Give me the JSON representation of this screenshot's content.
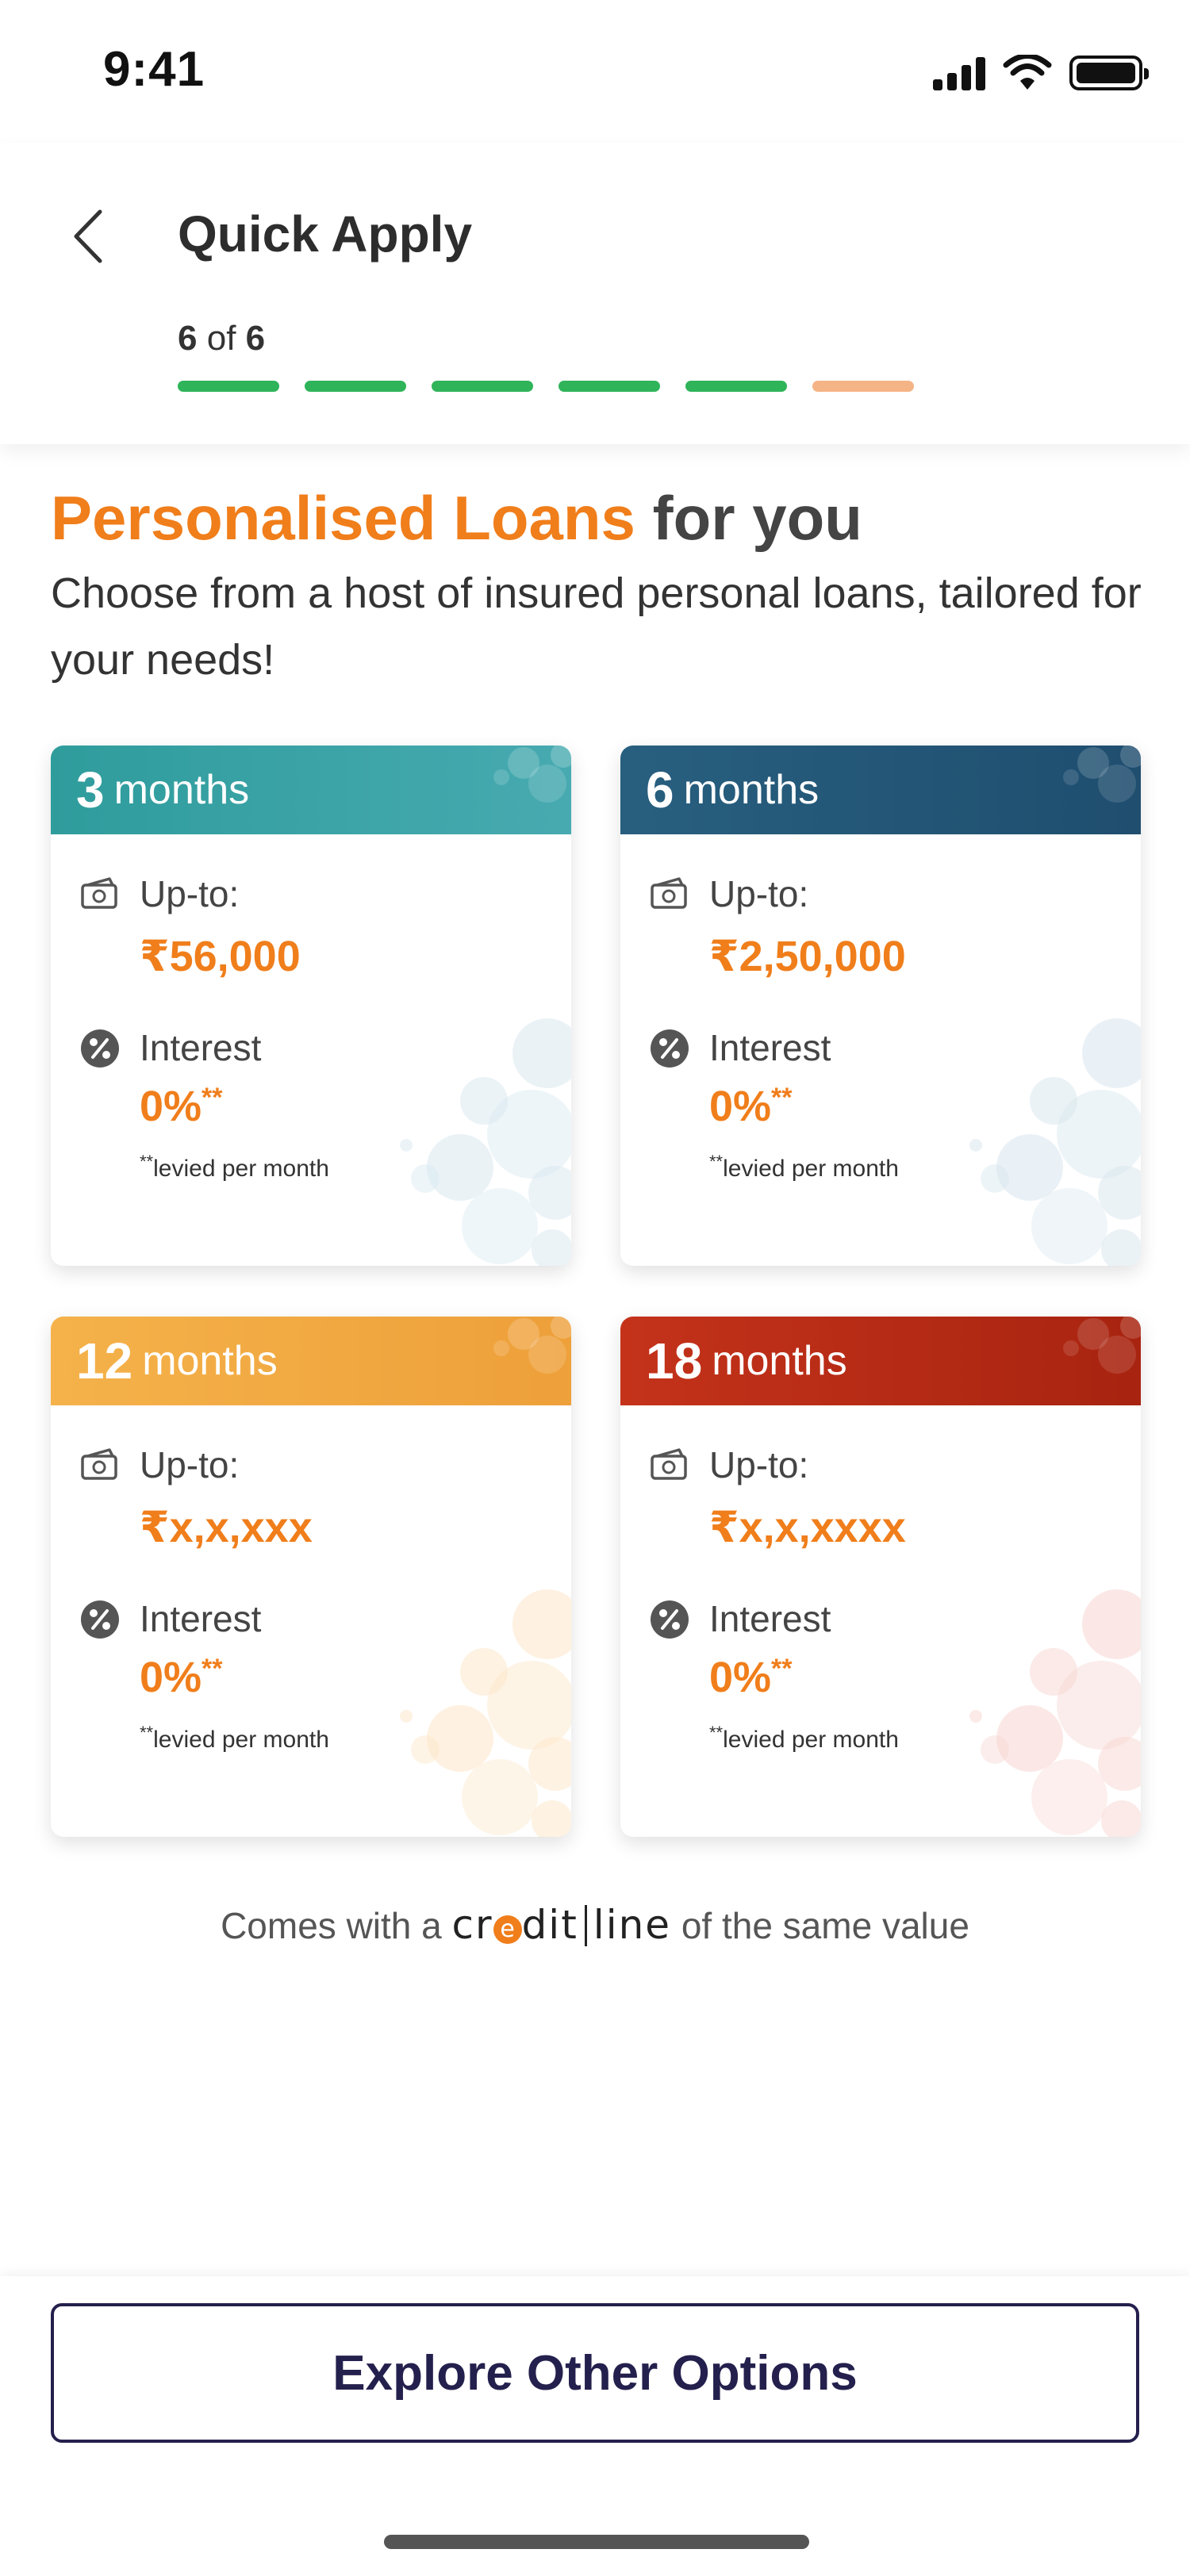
{
  "status_bar": {
    "time": "9:41",
    "icons": [
      "signal-icon",
      "wifi-icon",
      "battery-icon"
    ]
  },
  "header": {
    "back_icon": "chevron-left-icon",
    "title": "Quick Apply",
    "step_current": "6",
    "step_of": "of",
    "step_total": "6",
    "progress_completed": 5,
    "progress_total": 6
  },
  "hero": {
    "title_accent": "Personalised Loans",
    "title_rest": "for you",
    "subtitle": "Choose from a host of insured personal loans, tailored for your needs!"
  },
  "cards": [
    {
      "months": "3",
      "unit": "months",
      "upto_label": "Up-to:",
      "amount": "₹56,000",
      "interest_label": "Interest",
      "interest_value": "0%",
      "interest_marker": "**",
      "note_marker": "**",
      "note": "levied per month",
      "color": "#2f9c9c"
    },
    {
      "months": "6",
      "unit": "months",
      "upto_label": "Up-to:",
      "amount": "₹2,50,000",
      "interest_label": "Interest",
      "interest_value": "0%",
      "interest_marker": "**",
      "note_marker": "**",
      "note": "levied per month",
      "color": "#285f7f"
    },
    {
      "months": "12",
      "unit": "months",
      "upto_label": "Up-to:",
      "amount": "₹x,x,xxx",
      "interest_label": "Interest",
      "interest_value": "0%",
      "interest_marker": "**",
      "note_marker": "**",
      "note": "levied per month",
      "color": "#f5b24a"
    },
    {
      "months": "18",
      "unit": "months",
      "upto_label": "Up-to:",
      "amount": "₹x,x,xxxx",
      "interest_label": "Interest",
      "interest_value": "0%",
      "interest_marker": "**",
      "note_marker": "**",
      "note": "levied per month",
      "color": "#c4321a"
    }
  ],
  "creditline_note": {
    "prefix": "Comes with a",
    "brand_start": "cr",
    "brand_e": "e",
    "brand_mid": "dit",
    "brand_end": "line",
    "suffix": "of the same value"
  },
  "footer": {
    "explore_label": "Explore Other Options"
  },
  "colors": {
    "accent": "#f07e1b",
    "progress_done": "#2fb45a",
    "progress_current": "#f5b486",
    "button_text": "#24204d"
  }
}
